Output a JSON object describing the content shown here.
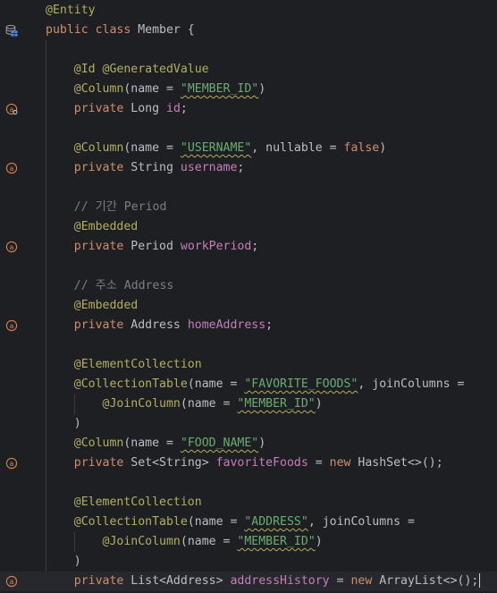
{
  "colors": {
    "background": "#1e1f22",
    "annotation": "#b3ae60",
    "keyword": "#cf8e6d",
    "string": "#6aab73",
    "field": "#c77dbb",
    "comment": "#7a7e85",
    "default": "#bcbec4",
    "gutter_icon": "#d7824b",
    "db_icon": "#548af7"
  },
  "lines": [
    {
      "icon": null,
      "tokens": [
        {
          "t": "@Entity",
          "c": "ann"
        }
      ]
    },
    {
      "icon": "database-table-icon",
      "tokens": [
        {
          "t": "public class ",
          "c": "kw"
        },
        {
          "t": "Member {",
          "c": "def"
        }
      ]
    },
    {
      "icon": null,
      "tokens": []
    },
    {
      "icon": null,
      "tokens": [
        {
          "t": "    "
        },
        {
          "t": "@Id @GeneratedValue",
          "c": "ann"
        }
      ]
    },
    {
      "icon": null,
      "tokens": [
        {
          "t": "    "
        },
        {
          "t": "@Column",
          "c": "ann"
        },
        {
          "t": "(name = ",
          "c": "def"
        },
        {
          "t": "\"MEMBER_ID\"",
          "c": "str",
          "sq": true
        },
        {
          "t": ")",
          "c": "def"
        }
      ]
    },
    {
      "icon": "primary-key-field-icon",
      "tokens": [
        {
          "t": "    "
        },
        {
          "t": "private ",
          "c": "kw"
        },
        {
          "t": "Long ",
          "c": "def"
        },
        {
          "t": "id",
          "c": "field"
        },
        {
          "t": ";",
          "c": "def"
        }
      ]
    },
    {
      "icon": null,
      "tokens": []
    },
    {
      "icon": null,
      "tokens": [
        {
          "t": "    "
        },
        {
          "t": "@Column",
          "c": "ann"
        },
        {
          "t": "(name = ",
          "c": "def"
        },
        {
          "t": "\"USERNAME\"",
          "c": "str",
          "sq": true
        },
        {
          "t": ", nullable = ",
          "c": "def"
        },
        {
          "t": "false",
          "c": "kw"
        },
        {
          "t": ")",
          "c": "def"
        }
      ]
    },
    {
      "icon": "field-icon",
      "tokens": [
        {
          "t": "    "
        },
        {
          "t": "private ",
          "c": "kw"
        },
        {
          "t": "String ",
          "c": "def"
        },
        {
          "t": "username",
          "c": "field"
        },
        {
          "t": ";",
          "c": "def"
        }
      ]
    },
    {
      "icon": null,
      "tokens": []
    },
    {
      "icon": null,
      "tokens": [
        {
          "t": "    "
        },
        {
          "t": "// 기간 Period",
          "c": "com"
        }
      ]
    },
    {
      "icon": null,
      "tokens": [
        {
          "t": "    "
        },
        {
          "t": "@Embedded",
          "c": "ann"
        }
      ]
    },
    {
      "icon": "field-icon",
      "tokens": [
        {
          "t": "    "
        },
        {
          "t": "private ",
          "c": "kw"
        },
        {
          "t": "Period ",
          "c": "def"
        },
        {
          "t": "workPeriod",
          "c": "field"
        },
        {
          "t": ";",
          "c": "def"
        }
      ]
    },
    {
      "icon": null,
      "tokens": []
    },
    {
      "icon": null,
      "tokens": [
        {
          "t": "    "
        },
        {
          "t": "// 주소 Address",
          "c": "com"
        }
      ]
    },
    {
      "icon": null,
      "tokens": [
        {
          "t": "    "
        },
        {
          "t": "@Embedded",
          "c": "ann"
        }
      ]
    },
    {
      "icon": "field-icon",
      "tokens": [
        {
          "t": "    "
        },
        {
          "t": "private ",
          "c": "kw"
        },
        {
          "t": "Address ",
          "c": "def"
        },
        {
          "t": "homeAddress",
          "c": "field"
        },
        {
          "t": ";",
          "c": "def"
        }
      ]
    },
    {
      "icon": null,
      "tokens": []
    },
    {
      "icon": null,
      "tokens": [
        {
          "t": "    "
        },
        {
          "t": "@ElementCollection",
          "c": "ann"
        }
      ]
    },
    {
      "icon": null,
      "tokens": [
        {
          "t": "    "
        },
        {
          "t": "@CollectionTable",
          "c": "ann"
        },
        {
          "t": "(name = ",
          "c": "def"
        },
        {
          "t": "\"FAVORITE_FOODS\"",
          "c": "str",
          "sq": true
        },
        {
          "t": ", joinColumns =",
          "c": "def"
        }
      ]
    },
    {
      "icon": null,
      "tokens": [
        {
          "t": "        "
        },
        {
          "t": "@JoinColumn",
          "c": "ann"
        },
        {
          "t": "(name = ",
          "c": "def"
        },
        {
          "t": "\"MEMBER_ID\"",
          "c": "str",
          "sq": true
        },
        {
          "t": ")",
          "c": "def"
        }
      ]
    },
    {
      "icon": null,
      "tokens": [
        {
          "t": "    "
        },
        {
          "t": ")",
          "c": "def"
        }
      ]
    },
    {
      "icon": null,
      "tokens": [
        {
          "t": "    "
        },
        {
          "t": "@Column",
          "c": "ann"
        },
        {
          "t": "(name = ",
          "c": "def"
        },
        {
          "t": "\"FOOD_NAME\"",
          "c": "str",
          "sq": true
        },
        {
          "t": ")",
          "c": "def"
        }
      ]
    },
    {
      "icon": "field-icon",
      "tokens": [
        {
          "t": "    "
        },
        {
          "t": "private ",
          "c": "kw"
        },
        {
          "t": "Set<String> ",
          "c": "def"
        },
        {
          "t": "favoriteFoods",
          "c": "field"
        },
        {
          "t": " = ",
          "c": "def"
        },
        {
          "t": "new ",
          "c": "kw"
        },
        {
          "t": "HashSet<>();",
          "c": "def"
        }
      ]
    },
    {
      "icon": null,
      "tokens": []
    },
    {
      "icon": null,
      "tokens": [
        {
          "t": "    "
        },
        {
          "t": "@ElementCollection",
          "c": "ann"
        }
      ]
    },
    {
      "icon": null,
      "tokens": [
        {
          "t": "    "
        },
        {
          "t": "@CollectionTable",
          "c": "ann"
        },
        {
          "t": "(name = ",
          "c": "def"
        },
        {
          "t": "\"ADDRESS\"",
          "c": "str",
          "sq": true
        },
        {
          "t": ", joinColumns =",
          "c": "def"
        }
      ]
    },
    {
      "icon": null,
      "tokens": [
        {
          "t": "        "
        },
        {
          "t": "@JoinColumn",
          "c": "ann"
        },
        {
          "t": "(name = ",
          "c": "def"
        },
        {
          "t": "\"MEMBER_ID\"",
          "c": "str",
          "sq": true
        },
        {
          "t": ")",
          "c": "def"
        }
      ]
    },
    {
      "icon": null,
      "tokens": [
        {
          "t": "    "
        },
        {
          "t": ")",
          "c": "def"
        }
      ]
    },
    {
      "icon": "field-icon",
      "current": true,
      "tokens": [
        {
          "t": "    "
        },
        {
          "t": "private ",
          "c": "kw"
        },
        {
          "t": "List<Address> ",
          "c": "def"
        },
        {
          "t": "addressHistory",
          "c": "field"
        },
        {
          "t": " = ",
          "c": "def"
        },
        {
          "t": "new ",
          "c": "kw"
        },
        {
          "t": "ArrayList<>();",
          "c": "def"
        }
      ]
    }
  ]
}
